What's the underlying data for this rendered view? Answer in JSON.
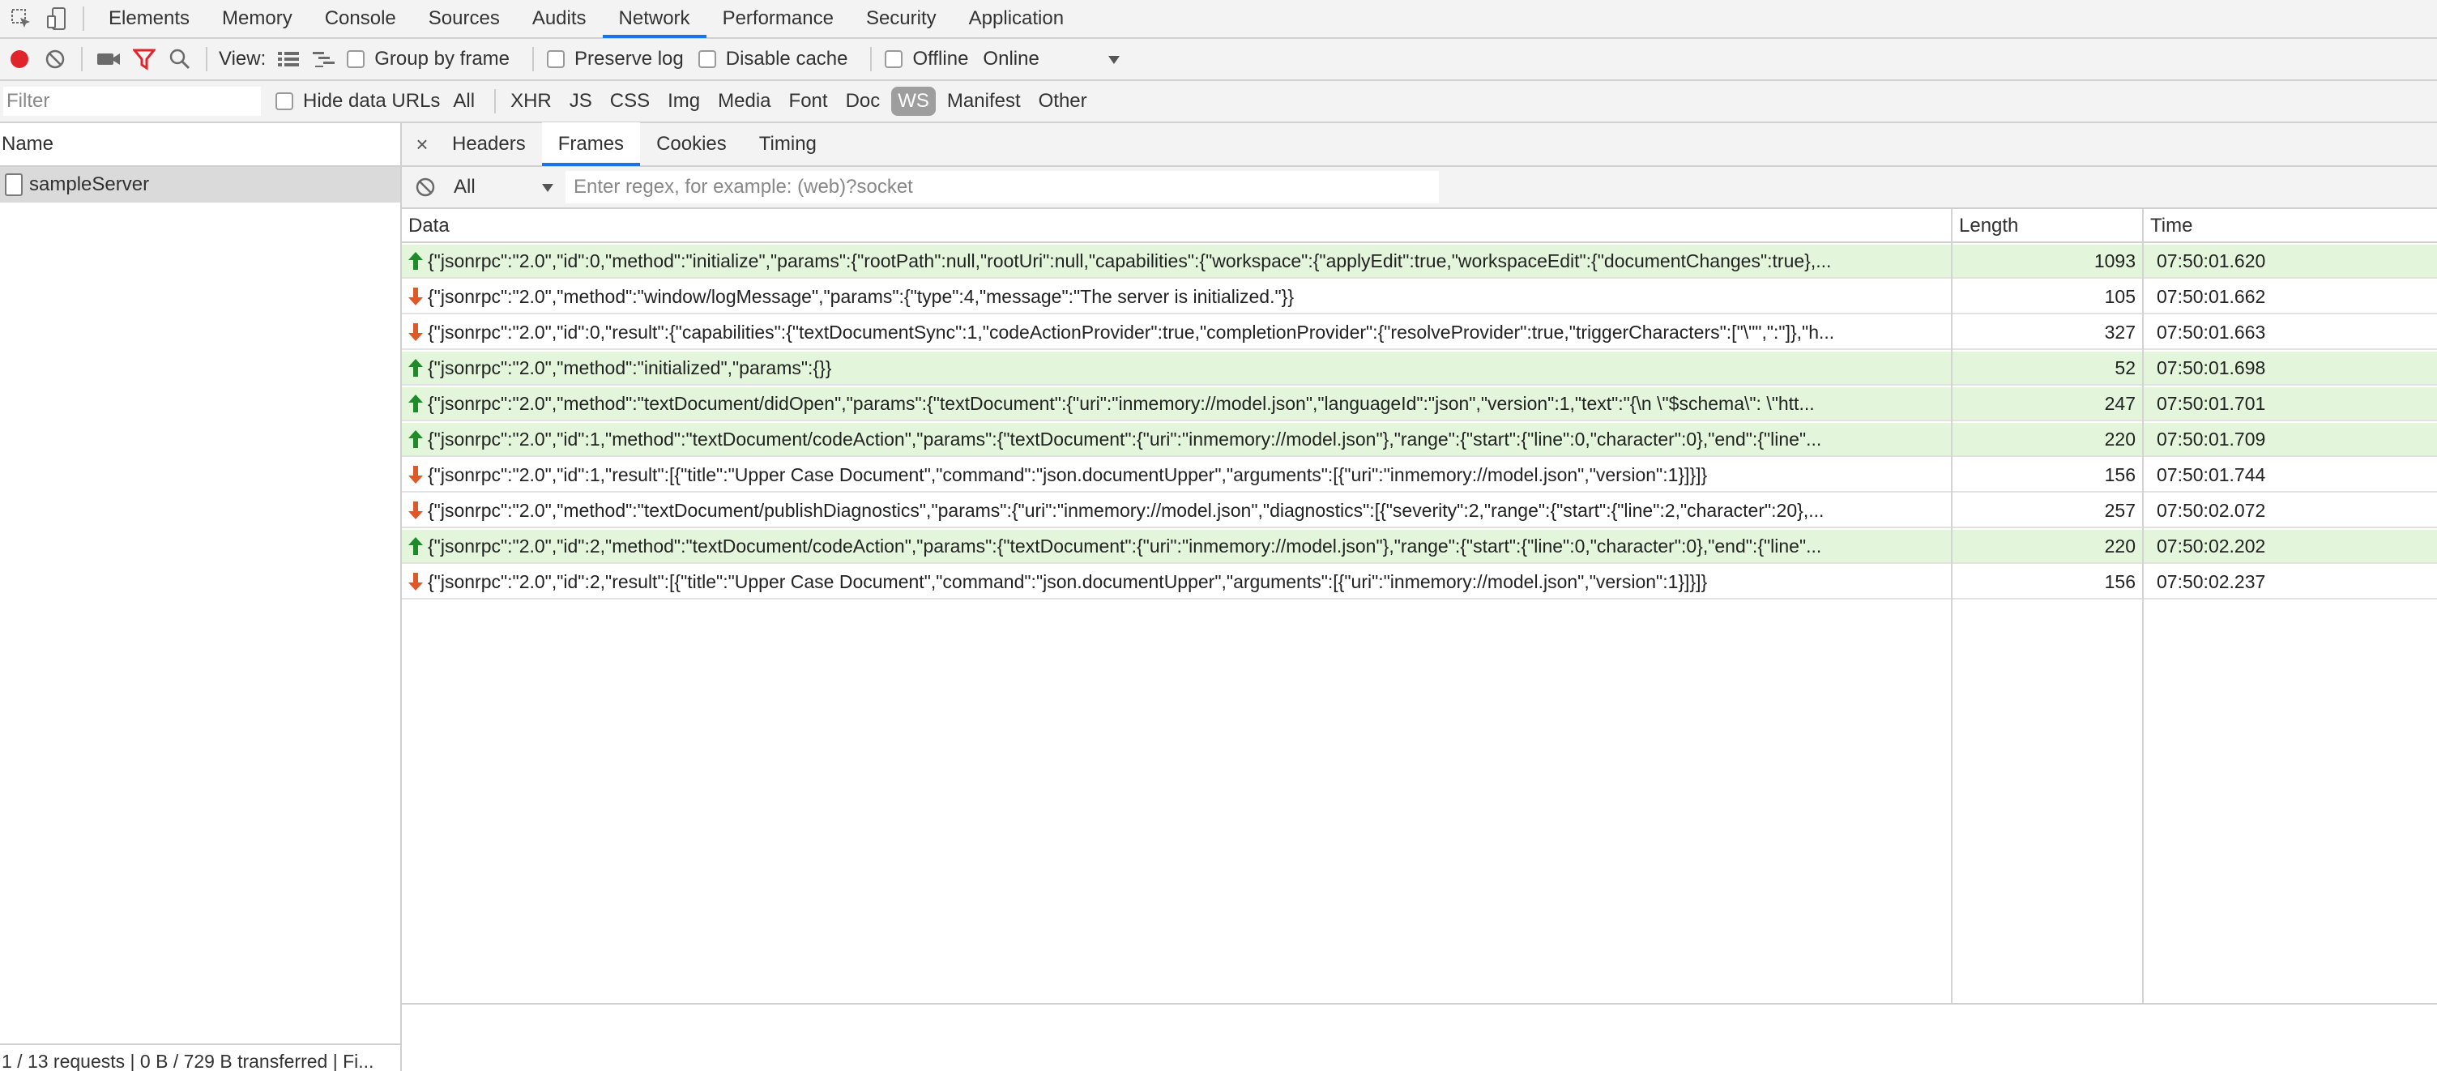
{
  "tabbar": {
    "tabs": [
      "Elements",
      "Memory",
      "Console",
      "Sources",
      "Audits",
      "Network",
      "Performance",
      "Security",
      "Application"
    ],
    "active": "Network"
  },
  "controls": {
    "view_label": "View:",
    "group_by_frame": "Group by frame",
    "preserve_log": "Preserve log",
    "disable_cache": "Disable cache",
    "offline": "Offline",
    "throttling": "Online",
    "record_color": "#e0242b",
    "filter_icon_color": "#e0242b"
  },
  "filterbar": {
    "placeholder": "Filter",
    "hide_data_urls": "Hide data URLs",
    "types": [
      "All",
      "XHR",
      "JS",
      "CSS",
      "Img",
      "Media",
      "Font",
      "Doc",
      "WS",
      "Manifest",
      "Other"
    ],
    "selected_type": "WS"
  },
  "requests": {
    "header": "Name",
    "items": [
      {
        "name": "sampleServer"
      }
    ],
    "status": "1 / 13 requests | 0 B / 729 B transferred | Fi..."
  },
  "detail": {
    "close": "×",
    "tabs": [
      "Headers",
      "Frames",
      "Cookies",
      "Timing"
    ],
    "active": "Frames",
    "frames_filter": "All",
    "regex_placeholder": "Enter regex, for example: (web)?socket"
  },
  "frames": {
    "columns": [
      "Data",
      "Length",
      "Time"
    ],
    "sent_arrow_color": "#1f8a2a",
    "recv_arrow_color": "#e0572a",
    "rows": [
      {
        "direction": "sent",
        "data": "{\"jsonrpc\":\"2.0\",\"id\":0,\"method\":\"initialize\",\"params\":{\"rootPath\":null,\"rootUri\":null,\"capabilities\":{\"workspace\":{\"applyEdit\":true,\"workspaceEdit\":{\"documentChanges\":true},...",
        "length": "1093",
        "time": "07:50:01.620"
      },
      {
        "direction": "recv",
        "data": "{\"jsonrpc\":\"2.0\",\"method\":\"window/logMessage\",\"params\":{\"type\":4,\"message\":\"The server is initialized.\"}}",
        "length": "105",
        "time": "07:50:01.662"
      },
      {
        "direction": "recv",
        "data": "{\"jsonrpc\":\"2.0\",\"id\":0,\"result\":{\"capabilities\":{\"textDocumentSync\":1,\"codeActionProvider\":true,\"completionProvider\":{\"resolveProvider\":true,\"triggerCharacters\":[\"\\\"\",\":\"]},\"h...",
        "length": "327",
        "time": "07:50:01.663"
      },
      {
        "direction": "sent",
        "data": "{\"jsonrpc\":\"2.0\",\"method\":\"initialized\",\"params\":{}}",
        "length": "52",
        "time": "07:50:01.698"
      },
      {
        "direction": "sent",
        "data": "{\"jsonrpc\":\"2.0\",\"method\":\"textDocument/didOpen\",\"params\":{\"textDocument\":{\"uri\":\"inmemory://model.json\",\"languageId\":\"json\",\"version\":1,\"text\":\"{\\n \\\"$schema\\\": \\\"htt...",
        "length": "247",
        "time": "07:50:01.701"
      },
      {
        "direction": "sent",
        "data": "{\"jsonrpc\":\"2.0\",\"id\":1,\"method\":\"textDocument/codeAction\",\"params\":{\"textDocument\":{\"uri\":\"inmemory://model.json\"},\"range\":{\"start\":{\"line\":0,\"character\":0},\"end\":{\"line\"...",
        "length": "220",
        "time": "07:50:01.709"
      },
      {
        "direction": "recv",
        "data": "{\"jsonrpc\":\"2.0\",\"id\":1,\"result\":[{\"title\":\"Upper Case Document\",\"command\":\"json.documentUpper\",\"arguments\":[{\"uri\":\"inmemory://model.json\",\"version\":1}]}]}",
        "length": "156",
        "time": "07:50:01.744"
      },
      {
        "direction": "recv",
        "data": "{\"jsonrpc\":\"2.0\",\"method\":\"textDocument/publishDiagnostics\",\"params\":{\"uri\":\"inmemory://model.json\",\"diagnostics\":[{\"severity\":2,\"range\":{\"start\":{\"line\":2,\"character\":20},...",
        "length": "257",
        "time": "07:50:02.072"
      },
      {
        "direction": "sent",
        "data": "{\"jsonrpc\":\"2.0\",\"id\":2,\"method\":\"textDocument/codeAction\",\"params\":{\"textDocument\":{\"uri\":\"inmemory://model.json\"},\"range\":{\"start\":{\"line\":0,\"character\":0},\"end\":{\"line\"...",
        "length": "220",
        "time": "07:50:02.202"
      },
      {
        "direction": "recv",
        "data": "{\"jsonrpc\":\"2.0\",\"id\":2,\"result\":[{\"title\":\"Upper Case Document\",\"command\":\"json.documentUpper\",\"arguments\":[{\"uri\":\"inmemory://model.json\",\"version\":1}]}]}",
        "length": "156",
        "time": "07:50:02.237"
      }
    ]
  }
}
